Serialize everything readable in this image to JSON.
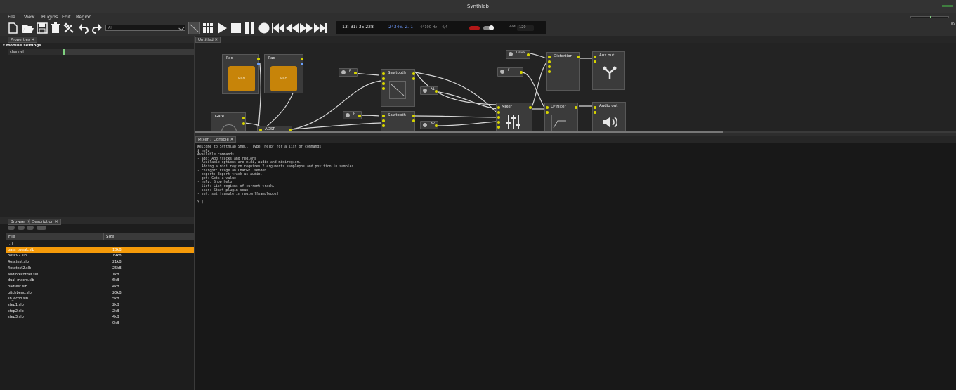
{
  "window": {
    "title": "Synthlab"
  },
  "menu": [
    "File",
    "View",
    "Plugins",
    "Edit",
    "Region"
  ],
  "toolbar": {
    "track_select_value": "All",
    "top_right_readout": "89"
  },
  "transport": {
    "time": "-13:-31:-35.228",
    "position": "-24346.-2.-1",
    "sample_rate": "44100 Hz",
    "signature": "4/4",
    "bpm_label": "BPM",
    "bpm": "120"
  },
  "properties": {
    "tab": "Properties",
    "section": "Module settings",
    "rows": [
      {
        "label": "channel"
      }
    ]
  },
  "browser": {
    "tabs": [
      "Browser",
      "Description"
    ],
    "columns": [
      "File",
      "Size"
    ],
    "files": [
      {
        "name": "[..]",
        "size": ""
      },
      {
        "name": "bass_tweak.slb",
        "size": "13kB",
        "selected": true
      },
      {
        "name": "3oscV2.slb",
        "size": "19kB"
      },
      {
        "name": "4osctest.slb",
        "size": "21kB"
      },
      {
        "name": "4osctest2.slb",
        "size": "25kB"
      },
      {
        "name": "audiorecorder.slb",
        "size": "1kB"
      },
      {
        "name": "dual_macro.slb",
        "size": "6kB"
      },
      {
        "name": "padtest.slb",
        "size": "4kB"
      },
      {
        "name": "pitchbend.slb",
        "size": "20kB"
      },
      {
        "name": "sh_echo.slb",
        "size": "5kB"
      },
      {
        "name": "step1.slb",
        "size": "2kB"
      },
      {
        "name": "step2.slb",
        "size": "2kB"
      },
      {
        "name": "step3.slb",
        "size": "4kB"
      },
      {
        "name": "",
        "size": "0kB"
      }
    ]
  },
  "graph": {
    "tab": "Untitled",
    "nodes": {
      "pad1": {
        "title": "Pad",
        "button": "Pad"
      },
      "pad2": {
        "title": "Pad",
        "button": "Pad"
      },
      "gate": {
        "title": "Gate"
      },
      "adsr": {
        "title": "ADSR"
      },
      "saw1": {
        "title": "Sawtooth"
      },
      "saw2": {
        "title": "Sawtooth"
      },
      "mixer": {
        "title": "Mixer"
      },
      "lp": {
        "title": "LP Filter"
      },
      "dist": {
        "title": "Distortion"
      },
      "auxout": {
        "title": "Aux out"
      },
      "audioout": {
        "title": "Audio out"
      },
      "drive": {
        "title": "Drive"
      },
      "f": {
        "title": "F"
      },
      "p1": {
        "title": "P"
      },
      "p2": {
        "title": "P"
      },
      "a1": {
        "title": "A1"
      },
      "a2": {
        "title": "A2"
      }
    }
  },
  "lower": {
    "tabs": [
      "Mixer",
      "Console"
    ],
    "console": [
      "Welcome to Synthlab Shell! Type 'help' for a list of commands.",
      "$ help",
      "Available commands:",
      "- add: Add tracks and regions",
      "  Available options are midi, audio and midiregion.",
      "  Adding a midi region requires 2 arguments samplepos and position in samples.",
      "- chatgpt: Frage an ChatGPT senden",
      "- export: Export track as audio.",
      "- get: Gets a value.",
      "- help: Show help.",
      "- list: List regions of current track.",
      "- scan: Start plugin scan.",
      "- set: set [sample in region][samplepos]",
      "",
      "$ |"
    ]
  }
}
